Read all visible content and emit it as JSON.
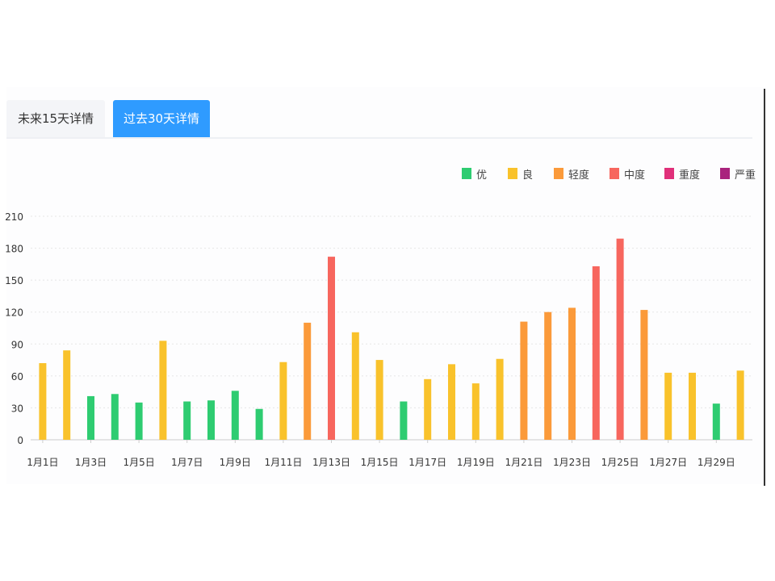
{
  "tabs": {
    "future_label": "未来15天详情",
    "past_label": "过去30天详情"
  },
  "legend": [
    {
      "label": "优",
      "color": "#2ecc71"
    },
    {
      "label": "良",
      "color": "#f9c22b"
    },
    {
      "label": "轻度",
      "color": "#fb9a3a"
    },
    {
      "label": "中度",
      "color": "#f7665e"
    },
    {
      "label": "重度",
      "color": "#e0307a"
    },
    {
      "label": "严重",
      "color": "#a9237d"
    }
  ],
  "chart_data": {
    "type": "bar",
    "title": "",
    "xlabel": "",
    "ylabel": "",
    "ylim": [
      0,
      210
    ],
    "yticks": [
      0,
      30,
      60,
      90,
      120,
      150,
      180,
      210
    ],
    "grid": true,
    "legend_position": "top-right",
    "categories": [
      "1月1日",
      "1月2日",
      "1月3日",
      "1月4日",
      "1月5日",
      "1月6日",
      "1月7日",
      "1月8日",
      "1月9日",
      "1月10日",
      "1月11日",
      "1月12日",
      "1月13日",
      "1月14日",
      "1月15日",
      "1月16日",
      "1月17日",
      "1月18日",
      "1月19日",
      "1月20日",
      "1月21日",
      "1月22日",
      "1月23日",
      "1月24日",
      "1月25日",
      "1月26日",
      "1月27日",
      "1月28日",
      "1月29日",
      "1月30日"
    ],
    "xtick_labels": [
      "1月1日",
      "1月3日",
      "1月5日",
      "1月7日",
      "1月9日",
      "1月11日",
      "1月13日",
      "1月15日",
      "1月17日",
      "1月19日",
      "1月21日",
      "1月23日",
      "1月25日",
      "1月27日",
      "1月29日"
    ],
    "values": [
      72,
      84,
      41,
      43,
      35,
      93,
      36,
      37,
      46,
      29,
      73,
      110,
      172,
      101,
      75,
      36,
      57,
      71,
      53,
      76,
      111,
      120,
      124,
      163,
      189,
      122,
      63,
      63,
      34,
      65
    ],
    "levels": [
      "良",
      "良",
      "优",
      "优",
      "优",
      "良",
      "优",
      "优",
      "优",
      "优",
      "良",
      "轻度",
      "中度",
      "良",
      "良",
      "优",
      "良",
      "良",
      "良",
      "良",
      "轻度",
      "轻度",
      "轻度",
      "中度",
      "中度",
      "轻度",
      "良",
      "良",
      "优",
      "良"
    ]
  }
}
